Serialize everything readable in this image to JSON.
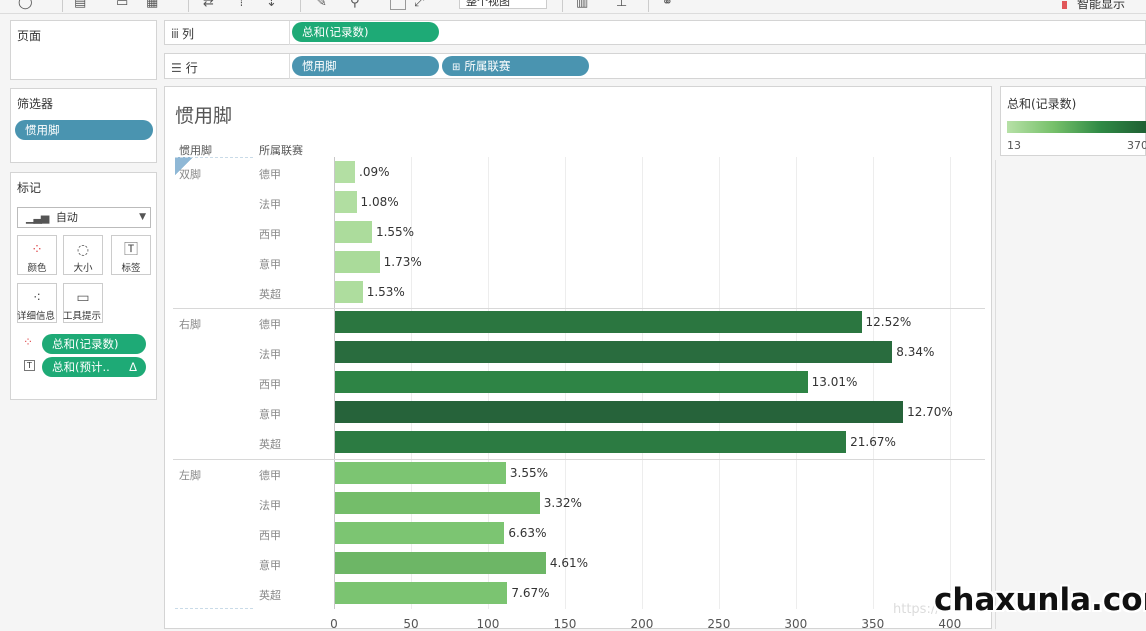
{
  "toolbar": {
    "view_select": "整个视图",
    "show_me": "智能显示"
  },
  "left": {
    "pages": {
      "title": "页面"
    },
    "filters": {
      "title": "筛选器",
      "pill": "惯用脚"
    },
    "marks": {
      "title": "标记",
      "type": "自动",
      "buttons": {
        "color": "颜色",
        "size": "大小",
        "label": "标签",
        "detail": "详细信息",
        "tooltip": "工具提示"
      },
      "pill1": "总和(记录数)",
      "pill2": "总和(预计..",
      "pill2_delta": "Δ"
    }
  },
  "shelves": {
    "columns": {
      "label": "列",
      "pill": "总和(记录数)"
    },
    "rows": {
      "label": "行",
      "pill1": "惯用脚",
      "pill2": "所属联赛"
    }
  },
  "view": {
    "title": "惯用脚",
    "header_foot": "惯用脚",
    "header_league": "所属联赛"
  },
  "legend": {
    "title": "总和(记录数)",
    "min": "13",
    "max": "370",
    "colors": [
      "#b7e1a7",
      "#1f5f33"
    ]
  },
  "chart_data": {
    "type": "bar",
    "orientation": "horizontal",
    "xlim": [
      0,
      400
    ],
    "x_ticks": [
      "0",
      "50",
      "100",
      "150",
      "200",
      "250",
      "300",
      "350",
      "400"
    ],
    "groups": [
      {
        "name": "双脚",
        "items": [
          {
            "category": "德甲",
            "value": 13,
            "label": ".09%",
            "color": "#b3dfa3"
          },
          {
            "category": "法甲",
            "value": 14,
            "label": "1.08%",
            "color": "#b1dea1"
          },
          {
            "category": "西甲",
            "value": 24,
            "label": "1.55%",
            "color": "#acdc9c"
          },
          {
            "category": "意甲",
            "value": 29,
            "label": "1.73%",
            "color": "#aadb9a"
          },
          {
            "category": "英超",
            "value": 18,
            "label": "1.53%",
            "color": "#aedd9e"
          }
        ]
      },
      {
        "name": "右脚",
        "items": [
          {
            "category": "德甲",
            "value": 342,
            "label": "12.52%",
            "color": "#2b7640"
          },
          {
            "category": "法甲",
            "value": 362,
            "label": "8.34%",
            "color": "#296c3e"
          },
          {
            "category": "西甲",
            "value": 307,
            "label": "13.01%",
            "color": "#2e8445"
          },
          {
            "category": "意甲",
            "value": 369,
            "label": "12.70%",
            "color": "#26633a"
          },
          {
            "category": "英超",
            "value": 332,
            "label": "21.67%",
            "color": "#2c7b42"
          }
        ]
      },
      {
        "name": "左脚",
        "items": [
          {
            "category": "德甲",
            "value": 111,
            "label": "3.55%",
            "color": "#7cc572"
          },
          {
            "category": "法甲",
            "value": 133,
            "label": "3.32%",
            "color": "#74bd6a"
          },
          {
            "category": "西甲",
            "value": 110,
            "label": "6.63%",
            "color": "#7cc572"
          },
          {
            "category": "意甲",
            "value": 137,
            "label": "4.61%",
            "color": "#6db666"
          },
          {
            "category": "英超",
            "value": 112,
            "label": "7.67%",
            "color": "#7bc471"
          }
        ]
      }
    ]
  },
  "watermark": {
    "faint": "https://",
    "main": "chaxunla.com"
  }
}
